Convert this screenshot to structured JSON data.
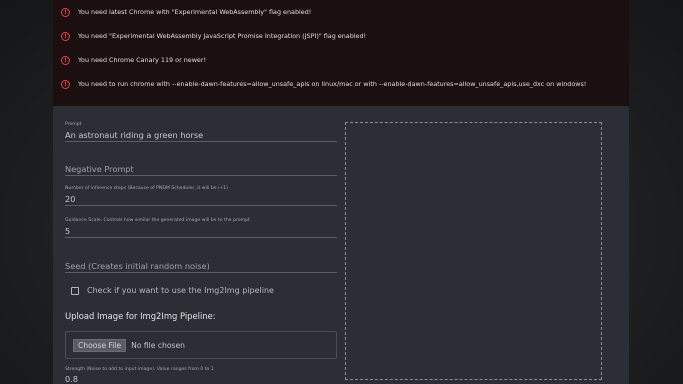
{
  "alerts": [
    "You need latest Chrome with \"Experimental WebAssembly\" flag enabled!",
    "You need \"Experimental WebAssembly JavaScript Promise Integration (JSPI)\" flag enabled!",
    "You need Chrome Canary 119 or newer!",
    "You need to run chrome with --enable-dawn-features=allow_unsafe_apis on linux/mac or with --enable-dawn-features=allow_unsafe_apis,use_dxc on windows!"
  ],
  "alert_icon": "!",
  "form": {
    "prompt_label": "Prompt",
    "prompt_value": "An astronaut riding a green horse",
    "negative_prompt_placeholder": "Negative Prompt",
    "steps_label": "Number of inference steps (Because of PNDM Scheduler, it will be i+1)",
    "steps_value": "20",
    "guidance_label": "Guidance Scale. Controls how similar the generated image will be to the prompt.",
    "guidance_value": "5",
    "seed_placeholder": "Seed (Creates initial random noise)",
    "img2img_checkbox_label": "Check if you want to use the Img2Img pipeline",
    "upload_title": "Upload Image for Img2Img Pipeline:",
    "file_button": "Choose File",
    "file_status": "No file chosen",
    "strength_label": "Strength (Noise to add to input image). Value ranges from 0 to 1",
    "strength_value": "0.8"
  },
  "colors": {
    "alert_icon": "#e04848",
    "alert_bg": "#1b0f0f",
    "card_bg": "#2c2e35"
  }
}
